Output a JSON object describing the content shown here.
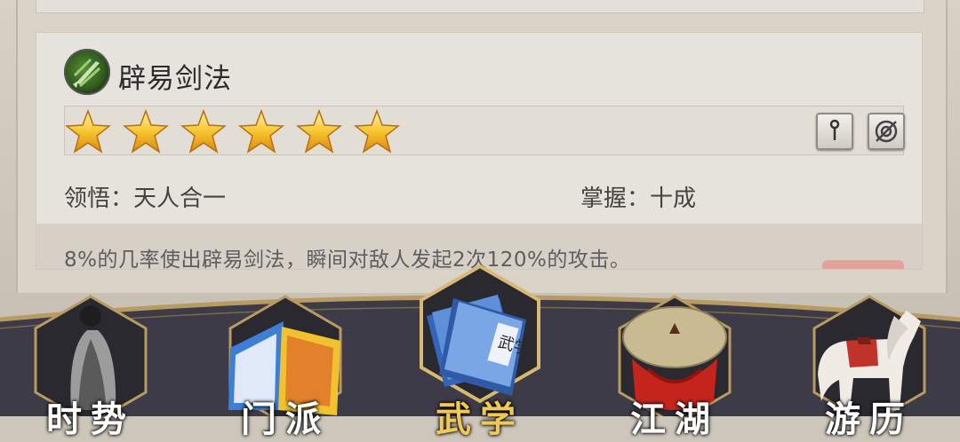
{
  "skill": {
    "name": "辟易剑法",
    "star_count": 6,
    "comprehension_label": "领悟：天人合一",
    "mastery_label": "掌握：十成",
    "description": "8%的几率使出辟易剑法，瞬间对敌人发起2次120%的攻击。"
  },
  "nav": {
    "items": [
      {
        "label": "时势",
        "icon": "figure-icon"
      },
      {
        "label": "门派",
        "icon": "banner-icon"
      },
      {
        "label": "武学",
        "icon": "scroll-books-icon"
      },
      {
        "label": "江湖",
        "icon": "straw-hat-icon"
      },
      {
        "label": "游历",
        "icon": "horse-icon"
      }
    ],
    "active_index": 2
  },
  "colors": {
    "accent_active": "#f0c85a",
    "nav_bg": "#3b3a45",
    "card_bg": "#e6e2dc"
  }
}
